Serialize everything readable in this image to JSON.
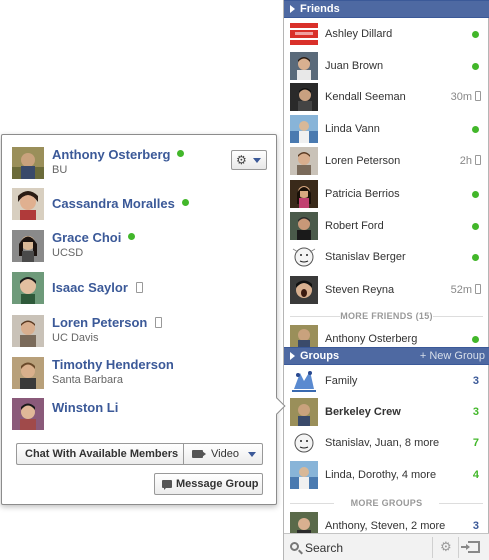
{
  "colors": {
    "header_blue": "#4e69a2",
    "link_blue": "#3b5998",
    "online_green": "#42b72a"
  },
  "group_flyout": {
    "members": [
      {
        "name": "Anthony Osterberg",
        "sub": "BU",
        "status": "online"
      },
      {
        "name": "Cassandra Moralles",
        "sub": "",
        "status": "online"
      },
      {
        "name": "Grace Choi",
        "sub": "UCSD",
        "status": "online"
      },
      {
        "name": "Isaac Saylor",
        "sub": "",
        "status": "mobile"
      },
      {
        "name": "Loren Peterson",
        "sub": "UC Davis",
        "status": "mobile"
      },
      {
        "name": "Timothy Henderson",
        "sub": "Santa Barbara",
        "status": "none"
      },
      {
        "name": "Winston Li",
        "sub": "",
        "status": "none"
      }
    ],
    "gear_icon": "gear-icon",
    "chat_button": "Chat With Available Members",
    "video_button": "Video",
    "message_button": "Message Group"
  },
  "sidebar": {
    "friends_header": "Friends",
    "friends": [
      {
        "name": "Ashley Dillard",
        "status": "online"
      },
      {
        "name": "Juan Brown",
        "status": "online"
      },
      {
        "name": "Kendall Seeman",
        "status": "idle",
        "idle": "30m"
      },
      {
        "name": "Linda Vann",
        "status": "online"
      },
      {
        "name": "Loren Peterson",
        "status": "idle",
        "idle": "2h"
      },
      {
        "name": "Patricia Berrios",
        "status": "online"
      },
      {
        "name": "Robert Ford",
        "status": "online"
      },
      {
        "name": "Stanislav Berger",
        "status": "online"
      },
      {
        "name": "Steven Reyna",
        "status": "idle",
        "idle": "52m"
      }
    ],
    "more_friends": "MORE FRIENDS (15)",
    "more_friends_list": [
      {
        "name": "Anthony Osterberg",
        "status": "online"
      }
    ],
    "groups_header": "Groups",
    "new_group": "+ New Group",
    "groups": [
      {
        "name": "Family",
        "count": "3",
        "count_color": "blue",
        "bold": false
      },
      {
        "name": "Berkeley Crew",
        "count": "3",
        "count_color": "green",
        "bold": true
      },
      {
        "name": "Stanislav, Juan, 8 more",
        "count": "7",
        "count_color": "green",
        "bold": false
      },
      {
        "name": "Linda, Dorothy, 4 more",
        "count": "4",
        "count_color": "green",
        "bold": false
      }
    ],
    "more_groups": "MORE GROUPS",
    "more_groups_list": [
      {
        "name": "Anthony, Steven, 2 more",
        "count": "3",
        "count_color": "blue"
      }
    ],
    "search_placeholder": "Search"
  }
}
